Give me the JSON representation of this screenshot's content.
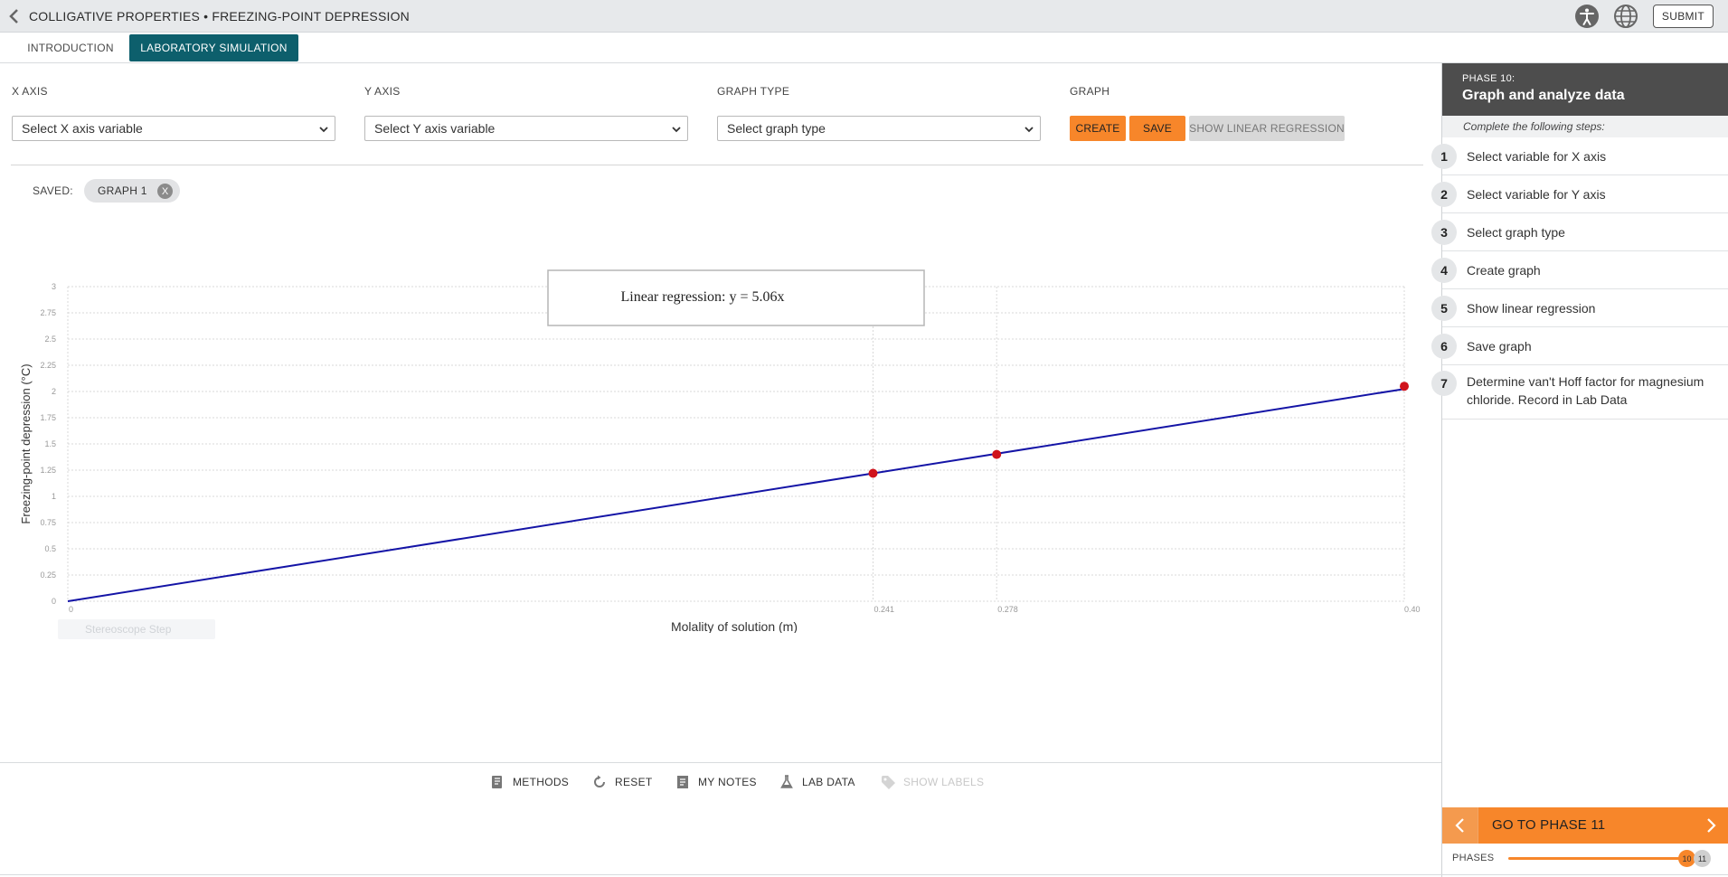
{
  "header": {
    "title": "COLLIGATIVE PROPERTIES • FREEZING-POINT DEPRESSION",
    "submit_label": "SUBMIT"
  },
  "tabs": [
    {
      "label": "INTRODUCTION",
      "active": false
    },
    {
      "label": "LABORATORY SIMULATION",
      "active": true
    }
  ],
  "controls": {
    "x_axis": {
      "label": "X AXIS",
      "value": "Select X axis variable"
    },
    "y_axis": {
      "label": "Y AXIS",
      "value": "Select Y axis variable"
    },
    "graph_type": {
      "label": "GRAPH TYPE",
      "value": "Select graph type"
    },
    "graph": {
      "label": "GRAPH",
      "create_label": "CREATE",
      "save_label": "SAVE",
      "regression_label": "SHOW LINEAR REGRESSION"
    }
  },
  "saved": {
    "label": "SAVED:",
    "chip_label": "GRAPH 1",
    "remove_label": "X"
  },
  "faded_item": "Stereoscope Step",
  "chart_data": {
    "type": "scatter",
    "ylabel": "Freezing-point depression (°C)",
    "xlabel": "Molality of solution (m)",
    "annotation": "Linear regression: y = 5.06x",
    "ylim": [
      0,
      3
    ],
    "y_ticks": [
      "0",
      "0.25",
      "0.5",
      "0.75",
      "1",
      "1.25",
      "1.5",
      "1.75",
      "2",
      "2.25",
      "2.5",
      "2.75",
      "3"
    ],
    "xlim": [
      0,
      0.4
    ],
    "x_ticks": [
      {
        "value": 0,
        "label": "0"
      },
      {
        "value": 0.241,
        "label": "0.241"
      },
      {
        "value": 0.278,
        "label": "0.278"
      },
      {
        "value": 0.4,
        "label": "0.40"
      }
    ],
    "points": [
      {
        "x": 0.241,
        "y": 1.22
      },
      {
        "x": 0.278,
        "y": 1.4
      },
      {
        "x": 0.4,
        "y": 2.05
      }
    ],
    "regression_slope": 5.06,
    "line_color": "#1414a6",
    "point_color": "#d0121b",
    "grid": true
  },
  "toolbar": {
    "methods": "METHODS",
    "reset": "RESET",
    "notes": "MY NOTES",
    "lab_data": "LAB DATA",
    "show_labels": "SHOW LABELS"
  },
  "panel": {
    "phase_number": "PHASE 10:",
    "phase_title": "Graph and analyze data",
    "instructions": "Complete the following steps:",
    "steps": [
      {
        "num": "1",
        "label": "Select variable for X axis"
      },
      {
        "num": "2",
        "label": "Select variable for Y axis"
      },
      {
        "num": "3",
        "label": "Select graph type"
      },
      {
        "num": "4",
        "label": "Create graph"
      },
      {
        "num": "5",
        "label": "Show linear regression"
      },
      {
        "num": "6",
        "label": "Save graph"
      },
      {
        "num": "7",
        "label": "Determine van't Hoff factor for magnesium chloride. Record in Lab Data"
      }
    ],
    "go_label": "GO TO PHASE 11",
    "phases_label": "PHASES",
    "current_phase": "10",
    "next_phase": "11"
  },
  "colors": {
    "accent": "#f7862a",
    "tab_active": "#0d5f6c",
    "panel_header": "#4d4d4d"
  }
}
